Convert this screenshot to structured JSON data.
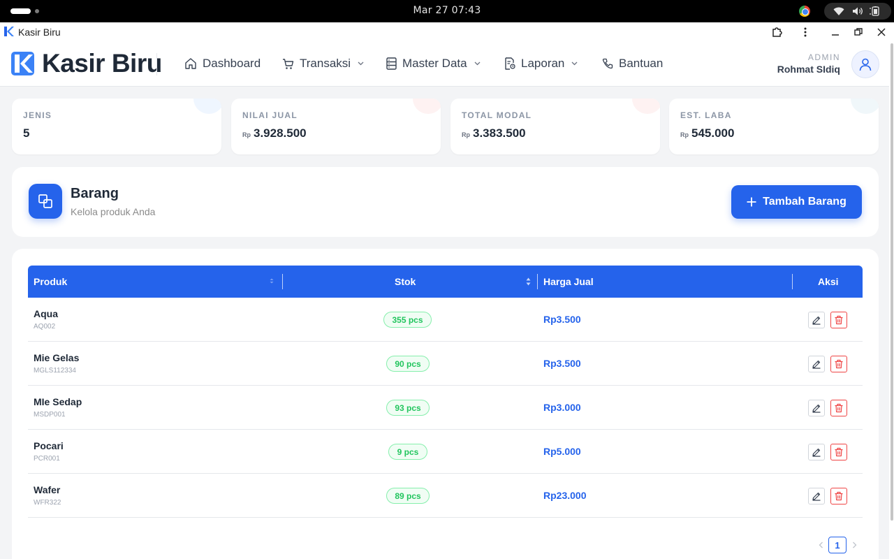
{
  "os": {
    "clock": "Mar 27  07:43"
  },
  "window": {
    "title": "Kasir Biru"
  },
  "nav": {
    "brand": "Kasir Biru",
    "items": [
      {
        "label": "Dashboard",
        "icon": "home-icon"
      },
      {
        "label": "Transaksi",
        "icon": "cart-icon",
        "dropdown": true
      },
      {
        "label": "Master Data",
        "icon": "database-icon",
        "dropdown": true
      },
      {
        "label": "Laporan",
        "icon": "report-icon",
        "dropdown": true
      },
      {
        "label": "Bantuan",
        "icon": "phone-icon"
      }
    ],
    "user": {
      "role": "ADMIN",
      "name": "Rohmat SIdiq"
    }
  },
  "stats": [
    {
      "label": "JENIS",
      "currency": "",
      "value": "5",
      "deco_color": "#eff6ff"
    },
    {
      "label": "NILAI JUAL",
      "currency": "Rp",
      "value": "3.928.500",
      "deco_color": "#fef2f2"
    },
    {
      "label": "TOTAL MODAL",
      "currency": "Rp",
      "value": "3.383.500",
      "deco_color": "#fef2f2"
    },
    {
      "label": "EST. LABA",
      "currency": "Rp",
      "value": "545.000",
      "deco_color": "#f0f7fa"
    }
  ],
  "header": {
    "title": "Barang",
    "subtitle": "Kelola produk Anda",
    "add_button": "Tambah Barang"
  },
  "table": {
    "columns": {
      "produk": "Produk",
      "stok": "Stok",
      "harga": "Harga Jual",
      "aksi": "Aksi"
    },
    "rows": [
      {
        "name": "Aqua",
        "code": "AQ002",
        "stock": "355 pcs",
        "price": "Rp3.500"
      },
      {
        "name": "Mie Gelas",
        "code": "MGLS112334",
        "stock": "90 pcs",
        "price": "Rp3.500"
      },
      {
        "name": "MIe Sedap",
        "code": "MSDP001",
        "stock": "93 pcs",
        "price": "Rp3.000"
      },
      {
        "name": "Pocari",
        "code": "PCR001",
        "stock": "9 pcs",
        "price": "Rp5.000"
      },
      {
        "name": "Wafer",
        "code": "WFR322",
        "stock": "89 pcs",
        "price": "Rp23.000"
      }
    ]
  },
  "pagination": {
    "current": "1"
  },
  "colors": {
    "primary": "#2563eb",
    "danger": "#ef4444",
    "success": "#22c55e"
  }
}
